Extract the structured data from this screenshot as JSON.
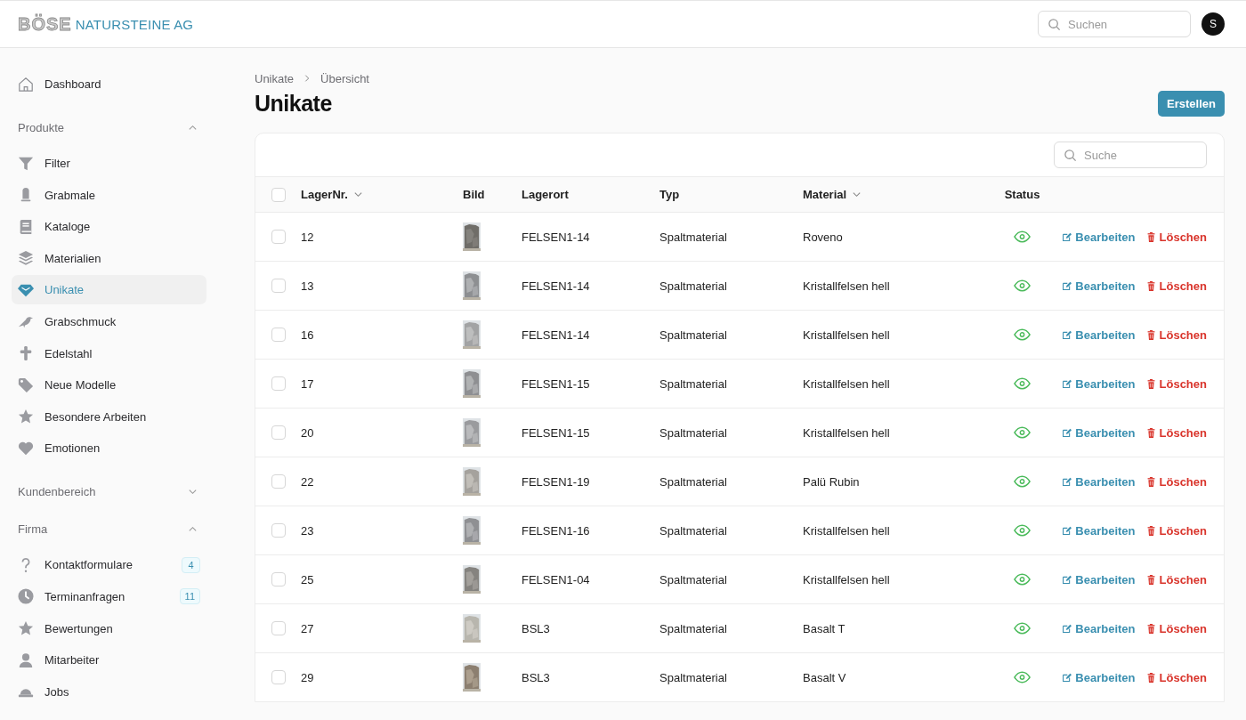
{
  "header": {
    "logo_mark": "BÖSE",
    "logo_text": "NATURSTEINE AG",
    "search": {
      "placeholder": "Suchen"
    },
    "avatar": "S"
  },
  "sidebar": {
    "top": [
      {
        "label": "Dashboard",
        "selected": false
      }
    ],
    "groups": [
      {
        "title": "Produkte",
        "expanded": true,
        "items": [
          {
            "label": "Filter",
            "selected": false
          },
          {
            "label": "Grabmale",
            "selected": false
          },
          {
            "label": "Kataloge",
            "selected": false
          },
          {
            "label": "Materialien",
            "selected": false
          },
          {
            "label": "Unikate",
            "selected": true
          },
          {
            "label": "Grabschmuck",
            "selected": false
          },
          {
            "label": "Edelstahl",
            "selected": false
          },
          {
            "label": "Neue Modelle",
            "selected": false
          },
          {
            "label": "Besondere Arbeiten",
            "selected": false
          },
          {
            "label": "Emotionen",
            "selected": false
          }
        ]
      },
      {
        "title": "Kundenbereich",
        "expanded": false
      },
      {
        "title": "Firma",
        "expanded": true,
        "items": [
          {
            "label": "Kontaktformulare",
            "selected": false,
            "badge": "4"
          },
          {
            "label": "Terminanfragen",
            "selected": false,
            "badge": "11"
          },
          {
            "label": "Bewertungen",
            "selected": false
          },
          {
            "label": "Mitarbeiter",
            "selected": false
          },
          {
            "label": "Jobs",
            "selected": false
          }
        ]
      }
    ]
  },
  "breadcrumb": [
    "Unikate",
    "Übersicht"
  ],
  "page_title": "Unikate",
  "create_button": "Erstellen",
  "table": {
    "search": {
      "placeholder": "Suche"
    },
    "columns": [
      {
        "label": "LagerNr.",
        "sortable": true
      },
      {
        "label": "Bild",
        "sortable": false
      },
      {
        "label": "Lagerort",
        "sortable": false
      },
      {
        "label": "Typ",
        "sortable": false
      },
      {
        "label": "Material",
        "sortable": true
      },
      {
        "label": "Status",
        "sortable": false
      }
    ],
    "header_checked": false,
    "rows": [
      {
        "checked": false,
        "lager_nr": "12",
        "lagerort": "FELSEN1-14",
        "typ": "Spaltmaterial",
        "material": "Roveno",
        "visible": true,
        "edit": "Bearbeiten",
        "delete": "Löschen"
      },
      {
        "checked": false,
        "lager_nr": "13",
        "lagerort": "FELSEN1-14",
        "typ": "Spaltmaterial",
        "material": "Kristallfelsen hell",
        "visible": true,
        "edit": "Bearbeiten",
        "delete": "Löschen"
      },
      {
        "checked": false,
        "lager_nr": "16",
        "lagerort": "FELSEN1-14",
        "typ": "Spaltmaterial",
        "material": "Kristallfelsen hell",
        "visible": true,
        "edit": "Bearbeiten",
        "delete": "Löschen"
      },
      {
        "checked": false,
        "lager_nr": "17",
        "lagerort": "FELSEN1-15",
        "typ": "Spaltmaterial",
        "material": "Kristallfelsen hell",
        "visible": true,
        "edit": "Bearbeiten",
        "delete": "Löschen"
      },
      {
        "checked": false,
        "lager_nr": "20",
        "lagerort": "FELSEN1-15",
        "typ": "Spaltmaterial",
        "material": "Kristallfelsen hell",
        "visible": true,
        "edit": "Bearbeiten",
        "delete": "Löschen"
      },
      {
        "checked": false,
        "lager_nr": "22",
        "lagerort": "FELSEN1-19",
        "typ": "Spaltmaterial",
        "material": "Palü Rubin",
        "visible": true,
        "edit": "Bearbeiten",
        "delete": "Löschen"
      },
      {
        "checked": false,
        "lager_nr": "23",
        "lagerort": "FELSEN1-16",
        "typ": "Spaltmaterial",
        "material": "Kristallfelsen hell",
        "visible": true,
        "edit": "Bearbeiten",
        "delete": "Löschen"
      },
      {
        "checked": false,
        "lager_nr": "25",
        "lagerort": "FELSEN1-04",
        "typ": "Spaltmaterial",
        "material": "Kristallfelsen hell",
        "visible": true,
        "edit": "Bearbeiten",
        "delete": "Löschen"
      },
      {
        "checked": false,
        "lager_nr": "27",
        "lagerort": "BSL3",
        "typ": "Spaltmaterial",
        "material": "Basalt T",
        "visible": true,
        "edit": "Bearbeiten",
        "delete": "Löschen"
      },
      {
        "checked": false,
        "lager_nr": "29",
        "lagerort": "BSL3",
        "typ": "Spaltmaterial",
        "material": "Basalt V",
        "visible": true,
        "edit": "Bearbeiten",
        "delete": "Löschen"
      }
    ]
  }
}
